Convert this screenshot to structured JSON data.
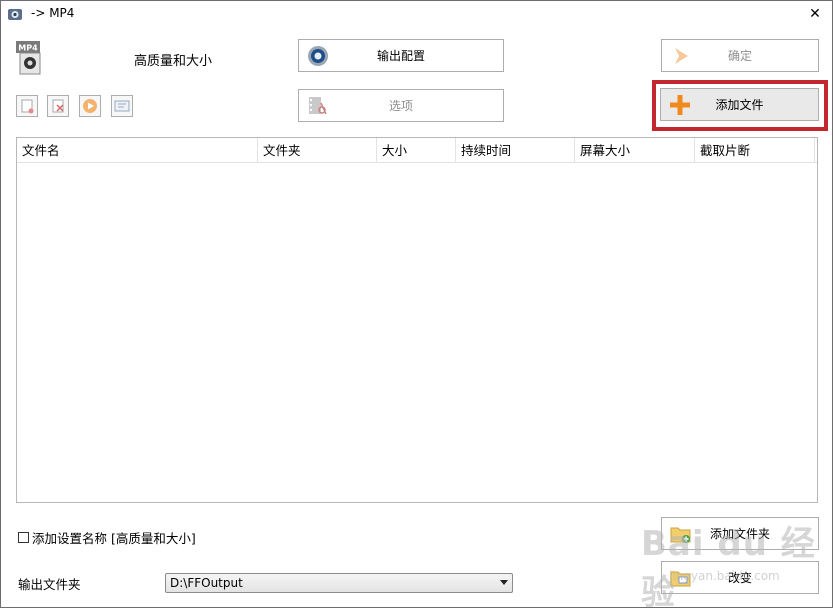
{
  "window": {
    "title": "-> MP4",
    "close_symbol": "✕"
  },
  "profile": {
    "format_badge": "MP4",
    "quality_label": "高质量和大小"
  },
  "buttons": {
    "output_config": "输出配置",
    "options": "选项",
    "ok": "确定",
    "add_file": "添加文件",
    "add_folder": "添加文件夹",
    "change": "改变"
  },
  "file_list": {
    "columns": [
      "文件名",
      "文件夹",
      "大小",
      "持续时间",
      "屏幕大小",
      "截取片断"
    ],
    "rows": []
  },
  "options_row": {
    "add_setting_name_label": "添加设置名称 [高质量和大小]",
    "checked": false
  },
  "output_folder": {
    "label": "输出文件夹",
    "value": "D:\\FFOutput"
  },
  "watermark": {
    "text": "Bai du 经验",
    "sub": "jingyan.baidu.com"
  },
  "colors": {
    "highlight": "#c2272d",
    "add_accent": "#f08a1c"
  }
}
